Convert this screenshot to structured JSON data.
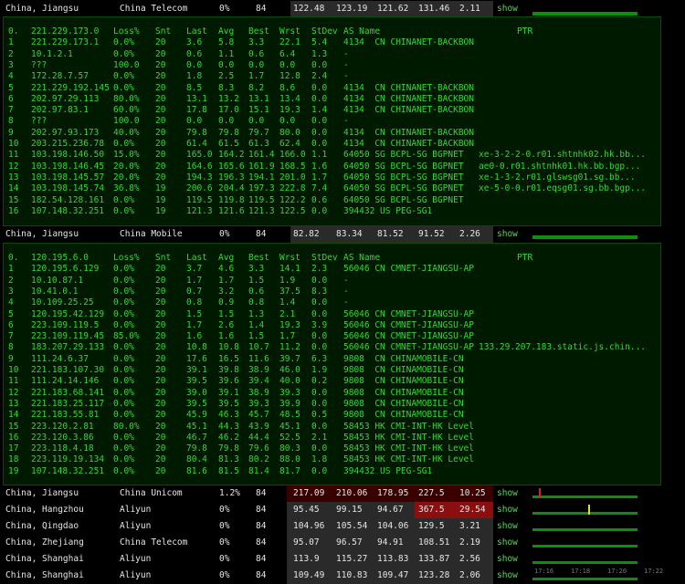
{
  "summary_top": {
    "location": "China, Jiangsu",
    "isp": "China Telecom",
    "loss": "0%",
    "sent": "84",
    "last": "122.48",
    "avg": "123.19",
    "best": "121.62",
    "worst": "131.46",
    "stdev": "2.11",
    "action": "show"
  },
  "mtr1": {
    "headers": {
      "idx": "0.",
      "host": "221.229.173.0",
      "loss": "Loss%",
      "snt": "Snt",
      "last": "Last",
      "avg": "Avg",
      "best": "Best",
      "wrst": "Wrst",
      "stdev": "StDev",
      "as": "AS Name",
      "ptr": "PTR"
    },
    "rows": [
      [
        "1",
        "221.229.173.1",
        "0.0%",
        "20",
        "3.6",
        "5.8",
        "3.3",
        "22.1",
        "5.4",
        "4134  CN CHINANET-BACKBON",
        ""
      ],
      [
        "2",
        "10.1.2.1",
        "0.0%",
        "20",
        "0.6",
        "1.1",
        "0.6",
        "6.4",
        "1.3",
        "-",
        ""
      ],
      [
        "3",
        "???",
        "100.0",
        "20",
        "0.0",
        "0.0",
        "0.0",
        "0.0",
        "0.0",
        "-",
        ""
      ],
      [
        "4",
        "172.28.7.57",
        "0.0%",
        "20",
        "1.8",
        "2.5",
        "1.7",
        "12.8",
        "2.4",
        "-",
        ""
      ],
      [
        "5",
        "221.229.192.145",
        "0.0%",
        "20",
        "8.5",
        "8.3",
        "8.2",
        "8.6",
        "0.0",
        "4134  CN CHINANET-BACKBON",
        ""
      ],
      [
        "6",
        "202.97.29.113",
        "80.0%",
        "20",
        "13.1",
        "13.2",
        "13.1",
        "13.4",
        "0.0",
        "4134  CN CHINANET-BACKBON",
        ""
      ],
      [
        "7",
        "202.97.83.1",
        "60.0%",
        "20",
        "17.8",
        "17.0",
        "15.1",
        "19.3",
        "1.4",
        "4134  CN CHINANET-BACKBON",
        ""
      ],
      [
        "8",
        "???",
        "100.0",
        "20",
        "0.0",
        "0.0",
        "0.0",
        "0.0",
        "0.0",
        "-",
        ""
      ],
      [
        "9",
        "202.97.93.173",
        "40.0%",
        "20",
        "79.8",
        "79.8",
        "79.7",
        "80.0",
        "0.0",
        "4134  CN CHINANET-BACKBON",
        ""
      ],
      [
        "10",
        "203.215.236.78",
        "0.0%",
        "20",
        "61.4",
        "61.5",
        "61.3",
        "62.4",
        "0.0",
        "4134  CN CHINANET-BACKBON",
        ""
      ],
      [
        "11",
        "103.198.146.50",
        "15.0%",
        "20",
        "165.0",
        "164.2",
        "161.4",
        "166.0",
        "1.1",
        "64050 SG BCPL-SG BGPNET",
        "xe-3-2-2-0.r01.shtnhk02.hk.bb..."
      ],
      [
        "12",
        "103.198.146.45",
        "20.0%",
        "20",
        "164.6",
        "165.6",
        "161.9",
        "168.5",
        "1.6",
        "64050 SG BCPL-SG BGPNET",
        "ae0-0.r01.shtnhk01.hk.bb.bgp..."
      ],
      [
        "13",
        "103.198.145.57",
        "20.0%",
        "20",
        "194.3",
        "196.3",
        "194.1",
        "201.0",
        "1.7",
        "64050 SG BCPL-SG BGPNET",
        "xe-1-3-2.r01.glswsg01.sg.bb..."
      ],
      [
        "14",
        "103.198.145.74",
        "36.8%",
        "19",
        "200.6",
        "204.4",
        "197.3",
        "222.8",
        "7.4",
        "64050 SG BCPL-SG BGPNET",
        "xe-5-0-0.r01.eqsg01.sg.bb.bgp..."
      ],
      [
        "15",
        "182.54.128.161",
        "0.0%",
        "19",
        "119.5",
        "119.8",
        "119.5",
        "122.2",
        "0.6",
        "64050 SG BCPL-SG BGPNET",
        ""
      ],
      [
        "16",
        "107.148.32.251",
        "0.0%",
        "19",
        "121.3",
        "121.6",
        "121.3",
        "122.5",
        "0.0",
        "394432 US PEG-SG1",
        ""
      ]
    ]
  },
  "summary_mid": {
    "location": "China, Jiangsu",
    "isp": "China Mobile",
    "loss": "0%",
    "sent": "84",
    "last": "82.82",
    "avg": "83.34",
    "best": "81.52",
    "worst": "91.52",
    "stdev": "2.26",
    "action": "show"
  },
  "mtr2": {
    "headers": {
      "idx": "0.",
      "host": "120.195.6.0",
      "loss": "Loss%",
      "snt": "Snt",
      "last": "Last",
      "avg": "Avg",
      "best": "Best",
      "wrst": "Wrst",
      "stdev": "StDev",
      "as": "AS Name",
      "ptr": "PTR"
    },
    "rows": [
      [
        "1",
        "120.195.6.129",
        "0.0%",
        "20",
        "3.7",
        "4.6",
        "3.3",
        "14.1",
        "2.3",
        "56046 CN CMNET-JIANGSU-AP",
        ""
      ],
      [
        "2",
        "10.10.87.1",
        "0.0%",
        "20",
        "1.7",
        "1.7",
        "1.5",
        "1.9",
        "0.0",
        "-",
        ""
      ],
      [
        "3",
        "10.41.0.1",
        "0.0%",
        "20",
        "0.7",
        "3.2",
        "0.6",
        "37.5",
        "8.3",
        "-",
        ""
      ],
      [
        "4",
        "10.109.25.25",
        "0.0%",
        "20",
        "0.8",
        "0.9",
        "0.8",
        "1.4",
        "0.0",
        "-",
        ""
      ],
      [
        "5",
        "120.195.42.129",
        "0.0%",
        "20",
        "1.5",
        "1.5",
        "1.3",
        "2.1",
        "0.0",
        "56046 CN CMNET-JIANGSU-AP",
        ""
      ],
      [
        "6",
        "223.109.119.5",
        "0.0%",
        "20",
        "1.7",
        "2.6",
        "1.4",
        "19.3",
        "3.9",
        "56046 CN CMNET-JIANGSU-AP",
        ""
      ],
      [
        "7",
        "223.109.119.45",
        "85.0%",
        "20",
        "1.6",
        "1.6",
        "1.5",
        "1.7",
        "0.0",
        "56046 CN CMNET-JIANGSU-AP",
        ""
      ],
      [
        "8",
        "183.207.29.133",
        "0.0%",
        "20",
        "10.8",
        "10.8",
        "10.7",
        "11.2",
        "0.0",
        "56046 CN CMNET-JIANGSU-AP",
        "133.29.207.183.static.js.chin..."
      ],
      [
        "9",
        "111.24.6.37",
        "0.0%",
        "20",
        "17.6",
        "16.5",
        "11.6",
        "39.7",
        "6.3",
        "9808  CN CHINAMOBILE-CN",
        ""
      ],
      [
        "10",
        "221.183.107.30",
        "0.0%",
        "20",
        "39.1",
        "39.8",
        "38.9",
        "46.0",
        "1.9",
        "9808  CN CHINAMOBILE-CN",
        ""
      ],
      [
        "11",
        "111.24.14.146",
        "0.0%",
        "20",
        "39.5",
        "39.6",
        "39.4",
        "40.0",
        "0.2",
        "9808  CN CHINAMOBILE-CN",
        ""
      ],
      [
        "12",
        "221.183.68.141",
        "0.0%",
        "20",
        "39.0",
        "39.1",
        "38.9",
        "39.3",
        "0.0",
        "9808  CN CHINAMOBILE-CN",
        ""
      ],
      [
        "13",
        "221.183.25.117",
        "0.0%",
        "20",
        "39.5",
        "39.5",
        "39.3",
        "39.9",
        "0.0",
        "9808  CN CHINAMOBILE-CN",
        ""
      ],
      [
        "14",
        "221.183.55.81",
        "0.0%",
        "20",
        "45.9",
        "46.3",
        "45.7",
        "48.5",
        "0.5",
        "9808  CN CHINAMOBILE-CN",
        ""
      ],
      [
        "15",
        "223.120.2.81",
        "80.0%",
        "20",
        "45.1",
        "44.3",
        "43.9",
        "45.1",
        "0.0",
        "58453 HK CMI-INT-HK Level",
        ""
      ],
      [
        "16",
        "223.120.3.86",
        "0.0%",
        "20",
        "46.7",
        "46.2",
        "44.4",
        "52.5",
        "2.1",
        "58453 HK CMI-INT-HK Level",
        ""
      ],
      [
        "17",
        "223.118.4.18",
        "0.0%",
        "20",
        "79.8",
        "79.8",
        "79.6",
        "80.3",
        "0.0",
        "58453 HK CMI-INT-HK Level",
        ""
      ],
      [
        "18",
        "223.119.19.134",
        "0.0%",
        "20",
        "80.4",
        "81.3",
        "80.2",
        "88.0",
        "1.8",
        "58453 HK CMI-INT-HK Level",
        ""
      ],
      [
        "19",
        "107.148.32.251",
        "0.0%",
        "20",
        "81.6",
        "81.5",
        "81.4",
        "81.7",
        "0.0",
        "394432 US PEG-SG1",
        ""
      ]
    ]
  },
  "summary_bottom": [
    {
      "location": "China, Jiangsu",
      "isp": "China Unicom",
      "loss": "1.2%",
      "sent": "84",
      "last": "217.09",
      "avg": "210.06",
      "best": "178.95",
      "worst": "227.5",
      "stdev": "10.25",
      "action": "show"
    },
    {
      "location": "China, Hangzhou",
      "isp": "Aliyun",
      "loss": "0%",
      "sent": "84",
      "last": "95.45",
      "avg": "99.15",
      "best": "94.67",
      "worst": "367.5",
      "stdev": "29.54",
      "action": "show"
    },
    {
      "location": "China, Qingdao",
      "isp": "Aliyun",
      "loss": "0%",
      "sent": "84",
      "last": "104.96",
      "avg": "105.54",
      "best": "104.06",
      "worst": "129.5",
      "stdev": "3.21",
      "action": "show"
    },
    {
      "location": "China, Zhejiang",
      "isp": "China Telecom",
      "loss": "0%",
      "sent": "84",
      "last": "95.07",
      "avg": "96.57",
      "best": "94.91",
      "worst": "108.51",
      "stdev": "2.19",
      "action": "show"
    },
    {
      "location": "China, Shanghai",
      "isp": "Aliyun",
      "loss": "0%",
      "sent": "84",
      "last": "113.9",
      "avg": "115.27",
      "best": "113.83",
      "worst": "133.87",
      "stdev": "2.56",
      "action": "show"
    },
    {
      "location": "China, Shanghai",
      "isp": "Aliyun",
      "loss": "0%",
      "sent": "84",
      "last": "109.49",
      "avg": "110.83",
      "best": "109.47",
      "worst": "123.28",
      "stdev": "2.06",
      "action": "show"
    }
  ],
  "axis_labels": [
    "17:16",
    "17:18",
    "17:20",
    "17:22"
  ],
  "colors": {
    "highlight": "#2a2a2a",
    "redcell": "#8b0f0f",
    "green": "#39d439",
    "bar": "#0c8f0c"
  }
}
